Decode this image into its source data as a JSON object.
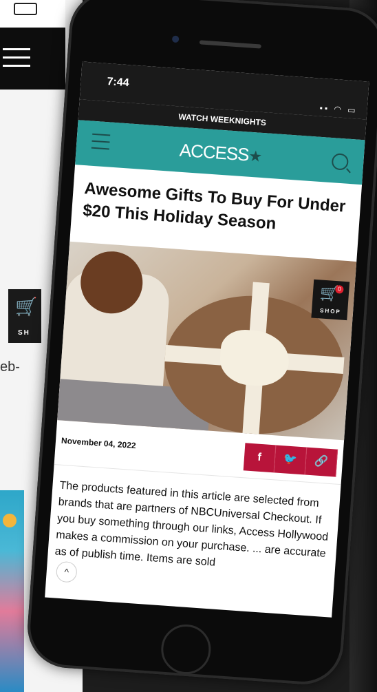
{
  "background": {
    "web_fragment": "eb-",
    "cart_label": "SH"
  },
  "status": {
    "time": "7:44",
    "icons": "▪▪ ◠ ▭"
  },
  "banner": {
    "text": "WATCH WEEKNIGHTS"
  },
  "header": {
    "logo": "ACCESS",
    "logo_star": "★"
  },
  "article": {
    "headline": "Awesome Gifts To Buy For Under $20 This Holiday Season",
    "date": "November 04, 2022",
    "body": "The products featured in this article are selected from brands that are partners of NBCUniversal Checkout. If you buy something through our links, Access Hollywood makes a commission on your purchase. ... are accurate as of publish time. Items are sold"
  },
  "shop_badge": {
    "count": "0",
    "label": "SHOP"
  },
  "share": {
    "facebook": "f",
    "twitter": "🐦",
    "link": "🔗"
  },
  "back_to_top": "^"
}
